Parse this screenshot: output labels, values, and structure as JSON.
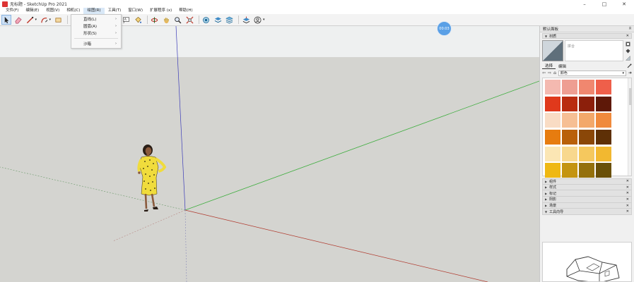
{
  "window": {
    "title": "无标题 - SketchUp Pro 2021",
    "controls": {
      "minimize": "–",
      "maximize": "□",
      "close": "✕"
    }
  },
  "menubar": {
    "items": [
      "文件(F)",
      "编辑(E)",
      "视图(V)",
      "相机(C)",
      "绘图(R)",
      "工具(T)",
      "窗口(W)",
      "扩展程序 (x)",
      "帮助(H)"
    ],
    "active_index": 4
  },
  "draw_menu": {
    "items": [
      {
        "label": "直线(L)",
        "submenu": true
      },
      {
        "label": "圆弧(A)",
        "submenu": true
      },
      {
        "label": "形状(S)",
        "submenu": true
      },
      {
        "label": "沙箱",
        "submenu": true
      }
    ],
    "arrow": "›"
  },
  "toolbar": {
    "tools": [
      "select-icon",
      "eraser-icon",
      "line-icon",
      "arc-icon",
      "rectangle-icon",
      "push-pull-icon",
      "rotate-icon",
      "scale-icon",
      "tape-measure-icon",
      "text-icon",
      "paint-bucket-icon",
      "orbit-icon",
      "pan-icon",
      "zoom-icon",
      "zoom-extents-icon",
      "section-icon",
      "top-view-icon",
      "layer-icon",
      "styles-icon",
      "account-icon"
    ]
  },
  "timer": {
    "text": "00:03"
  },
  "tray": {
    "title": "默认面板",
    "pin": "ʭ",
    "materials": {
      "header": "材质",
      "name_placeholder": "拼合",
      "tabs": [
        "选择",
        "编辑"
      ],
      "active_tab": 0,
      "library": "颜色",
      "swatches": [
        "#f4b9b0",
        "#ee9e92",
        "#f0876f",
        "#ef5f4a",
        "#e0391c",
        "#b92c10",
        "#8c1f0b",
        "#5e1808",
        "#f9dcc4",
        "#f6bf94",
        "#f3a86a",
        "#f08a3c",
        "#e77c0f",
        "#b9600a",
        "#8a4708",
        "#5e3006",
        "#fbe6b4",
        "#f8d88e",
        "#f5c85e",
        "#f2b830",
        "#efb813",
        "#c49410",
        "#94700c",
        "#6a5008"
      ]
    },
    "collapsed_panels": [
      "组件",
      "样式",
      "标记",
      "阴影",
      "场景",
      "工具向导"
    ]
  },
  "colors": {
    "sky": "#eef0f0",
    "ground": "#d4d4d0",
    "axis_red": "#b03a2e",
    "axis_green": "#3fae3f",
    "axis_blue": "#3b3bb8",
    "accent": "#5aa0e6"
  }
}
